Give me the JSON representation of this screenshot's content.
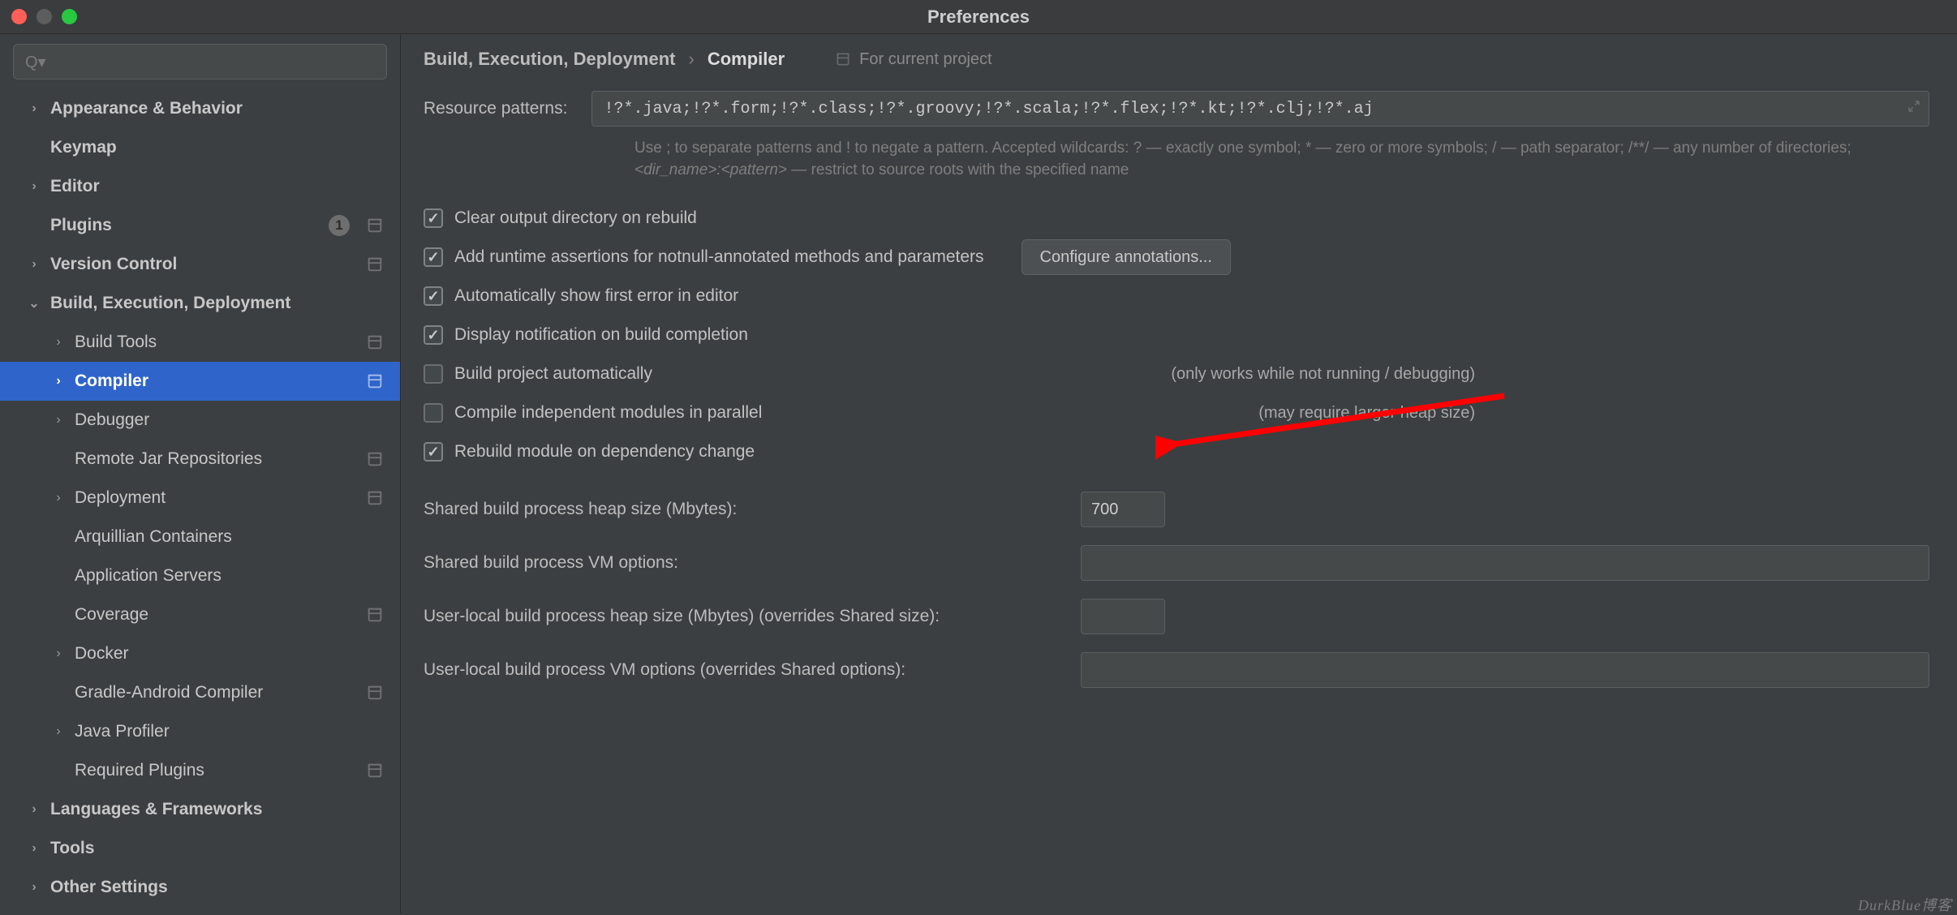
{
  "window": {
    "title": "Preferences"
  },
  "search": {
    "placeholder": ""
  },
  "sidebar": {
    "appearance": "Appearance & Behavior",
    "keymap": "Keymap",
    "editor": "Editor",
    "plugins": "Plugins",
    "plugins_badge": "1",
    "version_control": "Version Control",
    "bed": "Build, Execution, Deployment",
    "build_tools": "Build Tools",
    "compiler": "Compiler",
    "debugger": "Debugger",
    "remote_jar": "Remote Jar Repositories",
    "deployment": "Deployment",
    "arquillian": "Arquillian Containers",
    "app_servers": "Application Servers",
    "coverage": "Coverage",
    "docker": "Docker",
    "gradle_android": "Gradle-Android Compiler",
    "java_profiler": "Java Profiler",
    "required_plugins": "Required Plugins",
    "lang_frameworks": "Languages & Frameworks",
    "tools": "Tools",
    "other_settings": "Other Settings"
  },
  "breadcrumb": {
    "parent": "Build, Execution, Deployment",
    "current": "Compiler",
    "scope": "For current project"
  },
  "resource": {
    "label": "Resource patterns:",
    "value": "!?*.java;!?*.form;!?*.class;!?*.groovy;!?*.scala;!?*.flex;!?*.kt;!?*.clj;!?*.aj",
    "hint_prefix": "Use ; to separate patterns and ! to negate a pattern. Accepted wildcards: ? — exactly one symbol; * — zero or more symbols; / — path separator; /**/ — any number of directories; ",
    "hint_em": "<dir_name>:<pattern>",
    "hint_suffix": " — restrict to source roots with the specified name"
  },
  "checks": {
    "clear_output": "Clear output directory on rebuild",
    "add_runtime": "Add runtime assertions for notnull-annotated methods and parameters",
    "configure_btn": "Configure annotations...",
    "auto_show_error": "Automatically show first error in editor",
    "display_notification": "Display notification on build completion",
    "build_auto": "Build project automatically",
    "build_auto_note": "(only works while not running / debugging)",
    "compile_parallel": "Compile independent modules in parallel",
    "compile_parallel_note": "(may require larger heap size)",
    "rebuild_dep": "Rebuild module on dependency change"
  },
  "fields": {
    "shared_heap_label": "Shared build process heap size (Mbytes):",
    "shared_heap_value": "700",
    "shared_vm_label": "Shared build process VM options:",
    "shared_vm_value": "",
    "user_heap_label": "User-local build process heap size (Mbytes) (overrides Shared size):",
    "user_heap_value": "",
    "user_vm_label": "User-local build process VM options (overrides Shared options):",
    "user_vm_value": ""
  },
  "watermark": "DurkBlue博客"
}
